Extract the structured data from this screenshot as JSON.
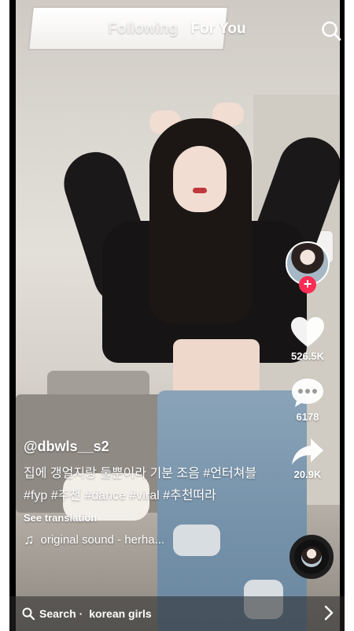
{
  "header": {
    "tabs": [
      {
        "label": "Following",
        "active": false
      },
      {
        "label": "For You",
        "active": true
      }
    ],
    "search_icon": "search-icon"
  },
  "rail": {
    "avatar_icon": "creator-avatar",
    "follow_label": "+",
    "likes": "526.5K",
    "comments": "6178",
    "shares": "20.9K"
  },
  "post": {
    "username": "@dbwls__s2",
    "description": "집에 갱얼지랑 둘뿐이라 기분 조음 #언터쳐블 #fyp #추천 #dance #viral #추천떠라",
    "see_translation": "See translation",
    "sound": "original sound - herha..."
  },
  "bottom_search": {
    "label": "Search ·",
    "query": "korean girls"
  },
  "colors": {
    "accent": "#fe2c55",
    "text": "#ffffff"
  }
}
